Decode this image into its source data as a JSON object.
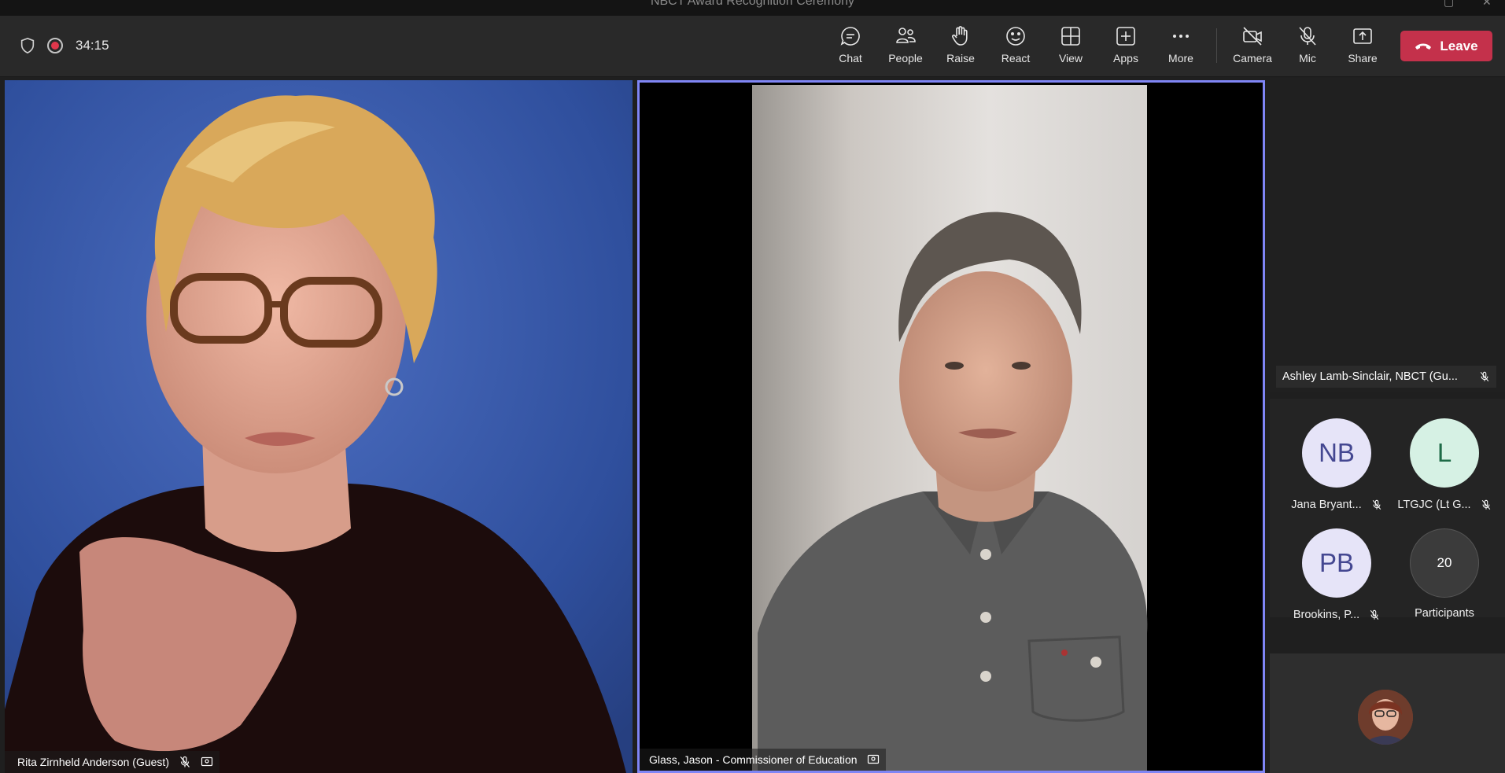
{
  "window": {
    "title": "NBCT Award Recognition Ceremony"
  },
  "toolbar": {
    "timer": "34:15",
    "buttons": {
      "chat": "Chat",
      "people": "People",
      "raise": "Raise",
      "react": "React",
      "view": "View",
      "apps": "Apps",
      "more": "More",
      "camera": "Camera",
      "mic": "Mic",
      "share": "Share"
    },
    "leave_label": "Leave"
  },
  "stage": {
    "left_tile": {
      "name": "Rita Zirnheld Anderson (Guest)"
    },
    "center_tile": {
      "name": "Glass, Jason - Commissioner of Education",
      "highlight_color": "#7f85f5"
    }
  },
  "rail": {
    "speaker_tag": "Ashley Lamb-Sinclair, NBCT (Gu...",
    "participants": [
      {
        "initials": "NB",
        "name": "Jana Bryant..."
      },
      {
        "initials": "L",
        "name": "LTGJC (Lt G..."
      },
      {
        "initials": "PB",
        "name": "Brookins, P..."
      }
    ],
    "overflow": {
      "count": "20",
      "label": "Participants"
    }
  },
  "colors": {
    "leave": "#c4314b",
    "record": "#e0374b",
    "active_border": "#7f85f5"
  }
}
